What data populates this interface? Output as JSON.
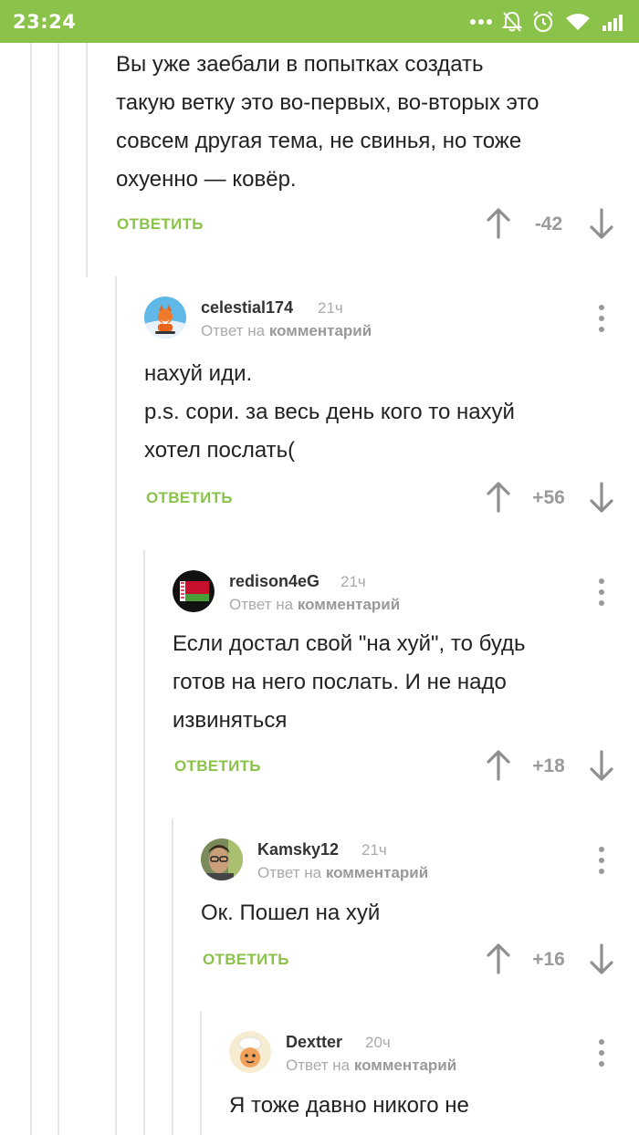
{
  "status_bar": {
    "time": "23:24",
    "icons": [
      "more-dots-icon",
      "notifications-off-icon",
      "alarm-icon",
      "wifi-icon",
      "signal-icon"
    ]
  },
  "colors": {
    "accent": "#8bc34a",
    "muted": "#aaaaaa",
    "rating": "#9a9a9a"
  },
  "comments": [
    {
      "text": "Вы уже заебали в попытках создать\nтакую ветку это во-первых, во-вторых это\nсовсем другая тема, не свинья, но тоже\nохуенно — ковёр.",
      "reply_label": "ОТВЕТИТЬ",
      "rating": "-42"
    },
    {
      "username": "celestial174",
      "time": "21ч",
      "reply_to_prefix": "Ответ на",
      "reply_to_link": "комментарий",
      "avatar": "fox-avatar-icon",
      "text": "нахуй иди.\np.s. сори. за весь день кого то нахуй\nхотел послать(",
      "reply_label": "ОТВЕТИТЬ",
      "rating": "+56"
    },
    {
      "username": "redison4eG",
      "time": "21ч",
      "reply_to_prefix": "Ответ на",
      "reply_to_link": "комментарий",
      "avatar": "belarus-flag-avatar-icon",
      "text": "Если достал свой \"на хуй\", то будь\nготов на него послать. И не надо\nизвиняться",
      "reply_label": "ОТВЕТИТЬ",
      "rating": "+18"
    },
    {
      "username": "Kamsky12",
      "time": "21ч",
      "reply_to_prefix": "Ответ на",
      "reply_to_link": "комментарий",
      "avatar": "photo-avatar-icon",
      "text": "Ок. Пошел на хуй",
      "reply_label": "ОТВЕТИТЬ",
      "rating": "+16"
    },
    {
      "username": "Dextter",
      "time": "20ч",
      "reply_to_prefix": "Ответ на",
      "reply_to_link": "комментарий",
      "avatar": "cartoon-avatar-icon",
      "text": "Я тоже давно никого не"
    }
  ]
}
